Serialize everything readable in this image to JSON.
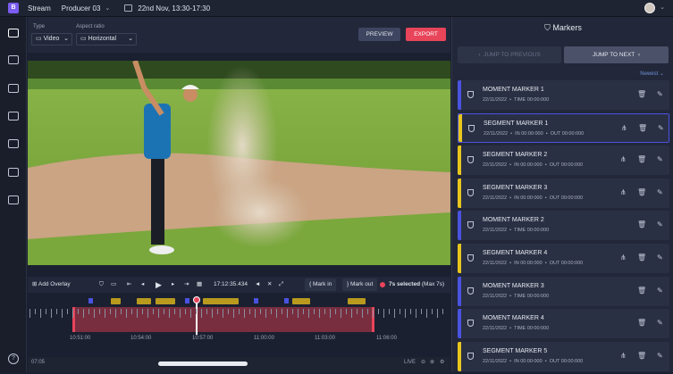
{
  "topbar": {
    "logo": "B",
    "section": "Stream",
    "producer": "Producer",
    "producer_num": "03",
    "date_range": "22nd Nov, 13:30-17:30"
  },
  "controls": {
    "type_label": "Type",
    "type_value": "Video",
    "aspect_label": "Aspect ratio",
    "aspect_value": "Horizontal",
    "preview": "PREVIEW",
    "export": "EXPORT"
  },
  "player": {
    "add_overlay": "Add Overlay",
    "timecode": "17:12:35.434",
    "mark_in": "Mark in",
    "mark_out": "Mark out",
    "selection": "7s selected",
    "selection_max": "(Max 7s)"
  },
  "timeline": {
    "labels": [
      "10:51:00",
      "10:54:00",
      "10:57:00",
      "11:00:00",
      "11:03:00",
      "11:06:00"
    ],
    "zoom": "07:05",
    "live": "LIVE"
  },
  "panel": {
    "title": "Markers",
    "jump_prev": "JUMP TO PREVIOUS",
    "jump_next": "JUMP TO NEXT",
    "sort": "Newest",
    "markers": [
      {
        "name": "MOMENT MARKER 1",
        "date": "22/11/2022",
        "time": "TIME 00:00:000",
        "kind": "moment",
        "color": "#4a52e0"
      },
      {
        "name": "SEGMENT MARKER 1",
        "date": "22/11/2022",
        "in": "IN 00:00:000",
        "out": "OUT 00:00:000",
        "kind": "segment",
        "color": "#e8c61e"
      },
      {
        "name": "SEGMENT MARKER 2",
        "date": "22/11/2022",
        "in": "IN 00:00:000",
        "out": "OUT 00:00:000",
        "kind": "segment",
        "color": "#e8c61e"
      },
      {
        "name": "SEGMENT MARKER 3",
        "date": "22/11/2022",
        "in": "IN 00:00:000",
        "out": "OUT 00:00:000",
        "kind": "segment",
        "color": "#e8c61e"
      },
      {
        "name": "MOMENT MARKER 2",
        "date": "22/11/2022",
        "time": "TIME 00:00:000",
        "kind": "moment",
        "color": "#4a52e0"
      },
      {
        "name": "SEGMENT MARKER 4",
        "date": "22/11/2022",
        "in": "IN 00:00:000",
        "out": "OUT 00:00:000",
        "kind": "segment",
        "color": "#e8c61e"
      },
      {
        "name": "MOMENT MARKER 3",
        "date": "22/11/2022",
        "time": "TIME 00:00:000",
        "kind": "moment",
        "color": "#4a52e0"
      },
      {
        "name": "MOMENT MARKER 4",
        "date": "22/11/2022",
        "time": "TIME 00:00:000",
        "kind": "moment",
        "color": "#4a52e0"
      },
      {
        "name": "SEGMENT MARKER 5",
        "date": "22/11/2022",
        "in": "IN 00:00:000",
        "out": "OUT 00:00:000",
        "kind": "segment",
        "color": "#e8c61e"
      }
    ]
  }
}
